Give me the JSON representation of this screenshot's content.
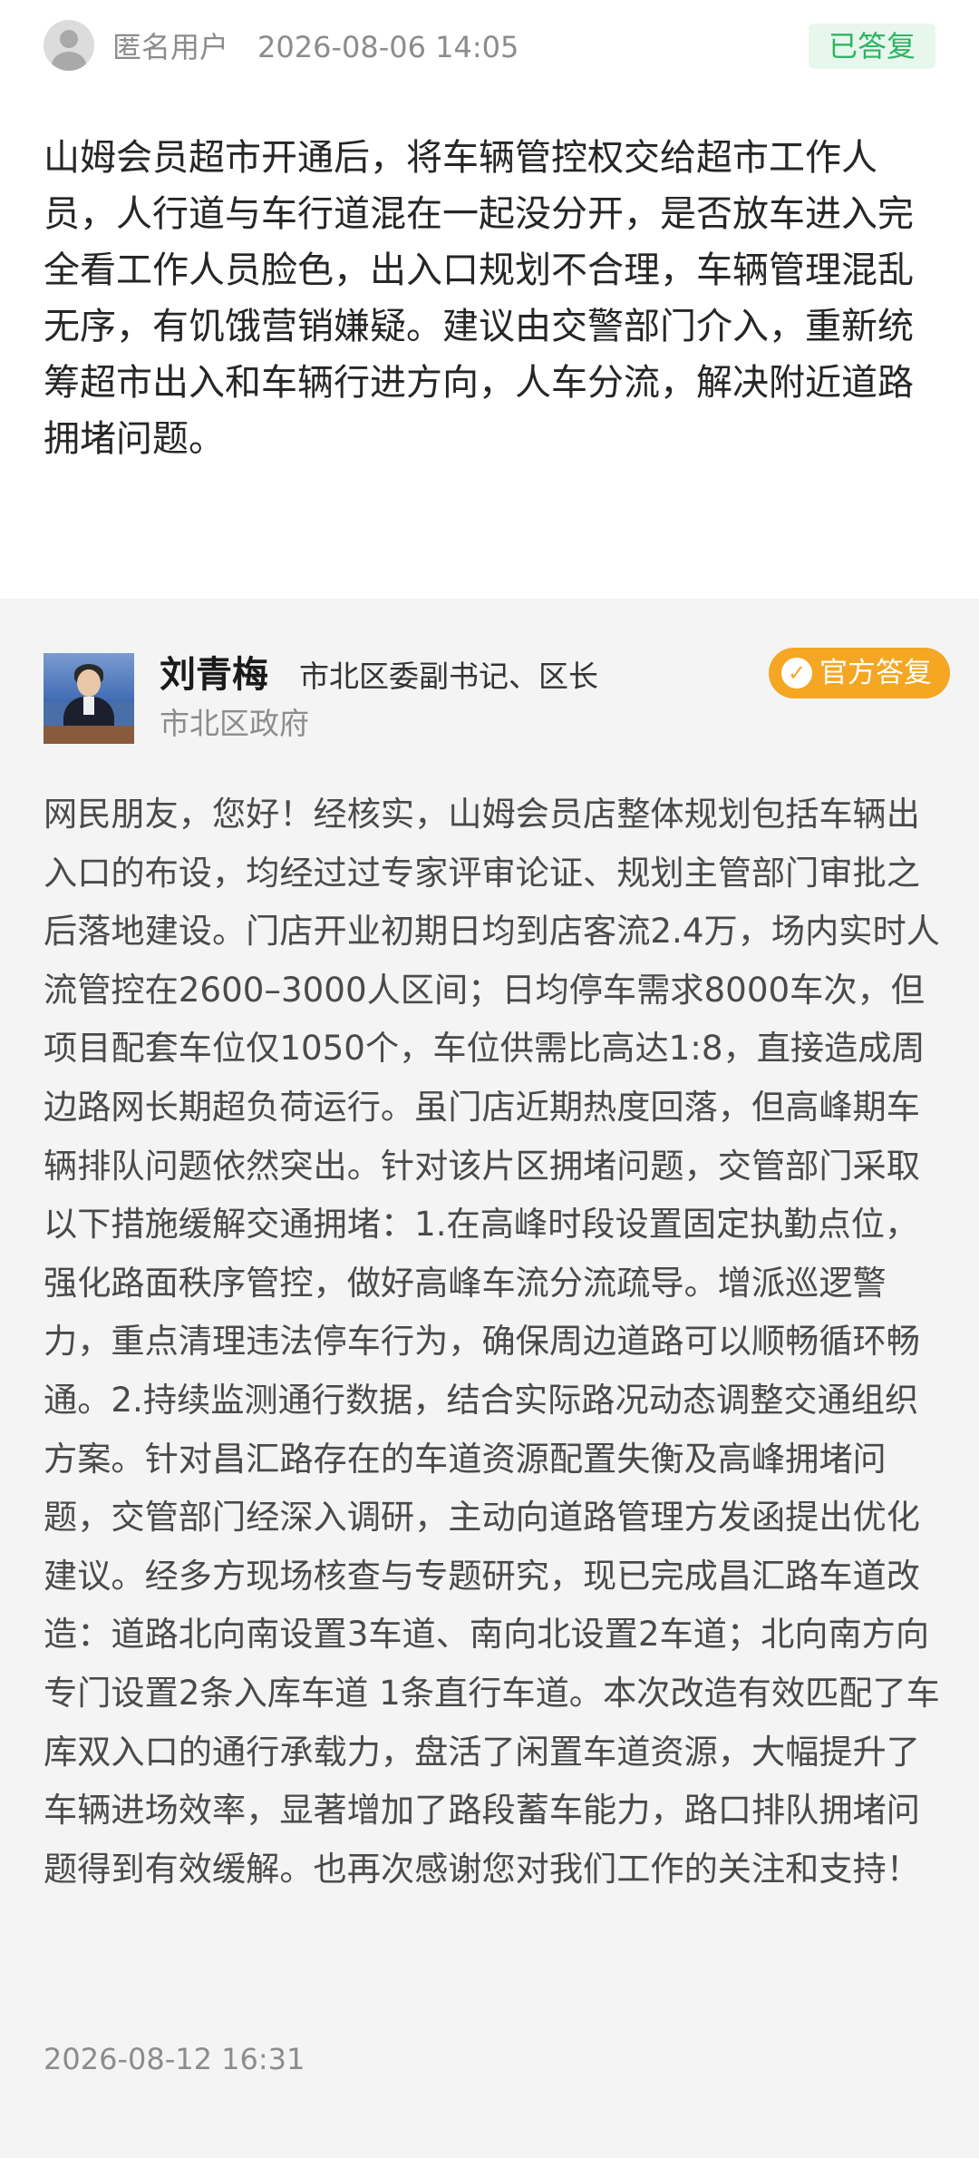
{
  "question": {
    "author": "匿名用户",
    "time": "2026-08-06 14:05",
    "status": "已答复",
    "text": "山姆会员超市开通后，将车辆管控权交给超市工作人员，人行道与车行道混在一起没分开，是否放车进入完全看工作人员脸色，出入口规划不合理，车辆管理混乱无序，有饥饿营销嫌疑。建议由交警部门介入，重新统筹超市出入和车辆行进方向，人车分流，解决附近道路拥堵问题。"
  },
  "answer": {
    "name": "刘青梅",
    "title": "市北区委副书记、区长",
    "org": "市北区政府",
    "badge": "官方答复",
    "text": "网民朋友，您好！经核实，山姆会员店整体规划包括车辆出入口的布设，均经过过专家评审论证、规划主管部门审批之后落地建设。门店开业初期日均到店客流2.4万，场内实时人流管控在2600–3000人区间；日均停车需求8000车次，但项目配套车位仅1050个，车位供需比高达1:8，直接造成周边路网长期超负荷运行。虽门店近期热度回落，但高峰期车辆排队问题依然突出。针对该片区拥堵问题，交管部门采取以下措施缓解交通拥堵：1.在高峰时段设置固定执勤点位，强化路面秩序管控，做好高峰车流分流疏导。增派巡逻警力，重点清理违法停车行为，确保周边道路可以顺畅循环畅通。2.持续监测通行数据，结合实际路况动态调整交通组织方案。针对昌汇路存在的车道资源配置失衡及高峰拥堵问题，交管部门经深入调研，主动向道路管理方发函提出优化建议。经多方现场核查与专题研究，现已完成昌汇路车道改造：道路北向南设置3车道、南向北设置2车道；北向南方向专门设置2条入库车道 1条直行车道。本次改造有效匹配了车库双入口的通行承载力，盘活了闲置车道资源，大幅提升了车辆进场效率，显著增加了路段蓄车能力，路口排队拥堵问题得到有效缓解。也再次感谢您对我们工作的关注和支持！",
    "time": "2026-08-12 16:31"
  },
  "colors": {
    "status_green": "#2fb462",
    "badge_orange": "#f5a623",
    "answer_bg": "#f4f4f4"
  },
  "icons": {
    "avatar": "user-avatar-icon",
    "badge": "check-circle-icon"
  }
}
